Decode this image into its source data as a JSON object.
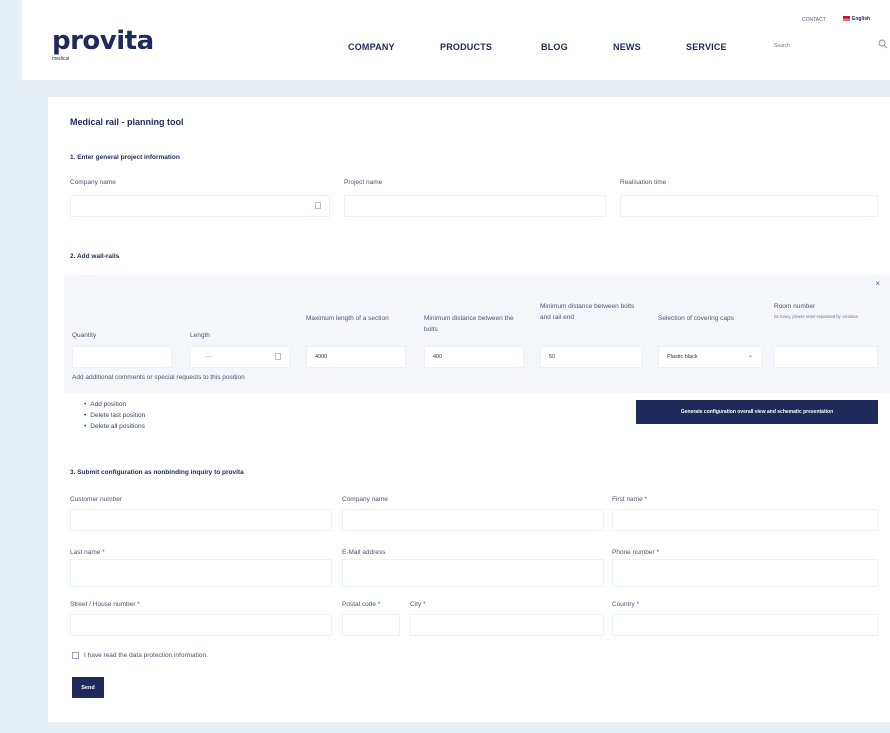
{
  "header": {
    "logo": "provita",
    "logo_sub": "medical",
    "nav": [
      "COMPANY",
      "PRODUCTS",
      "BLOG",
      "NEWS",
      "SERVICE"
    ],
    "contact": "CONTACT",
    "language": "English",
    "search_placeholder": "Search"
  },
  "page": {
    "title": "Medical rail - planning tool",
    "section1": {
      "heading": "1. Enter general project information",
      "company_label": "Company name",
      "project_label": "Project name",
      "realisation_label": "Realisation time"
    },
    "section2": {
      "heading": "2. Add wall-rails",
      "quantity_label": "Quantity",
      "length_label": "Length",
      "length_placeholder": "----",
      "max_length_label": "Maximum length of a section",
      "max_length_value": "4000",
      "min_distance_label": "Minimum distance between the bolts",
      "min_distance_value": "400",
      "min_distance_end_label": "Minimum distance between bolts and rail end",
      "min_distance_end_value": "50",
      "caps_label": "Selection of covering caps",
      "caps_value": "Plastic black",
      "room_label": "Room number",
      "room_hint": "for many, please enter separated by commas",
      "comments_label": "Add additional comments or special requests to this position",
      "actions": [
        "Add position",
        "Delete last position",
        "Delete all positions"
      ],
      "generate_button": "Generate configuration overall view and schematic presentation"
    },
    "section3": {
      "heading": "3. Submit configuration as nonbinding inquiry to provita",
      "customer_number": "Customer number",
      "company_name": "Company name",
      "first_name": "First name *",
      "last_name": "Last name *",
      "email": "E-Mail address",
      "phone": "Phone number *",
      "street": "Street / House number *",
      "postal": "Postal code *",
      "city": "City *",
      "country": "Country *",
      "privacy": "I have read the data protection information.",
      "send_button": "Send"
    }
  },
  "colors": {
    "brand": "#1e2a5a",
    "background": "#e6eef6"
  }
}
